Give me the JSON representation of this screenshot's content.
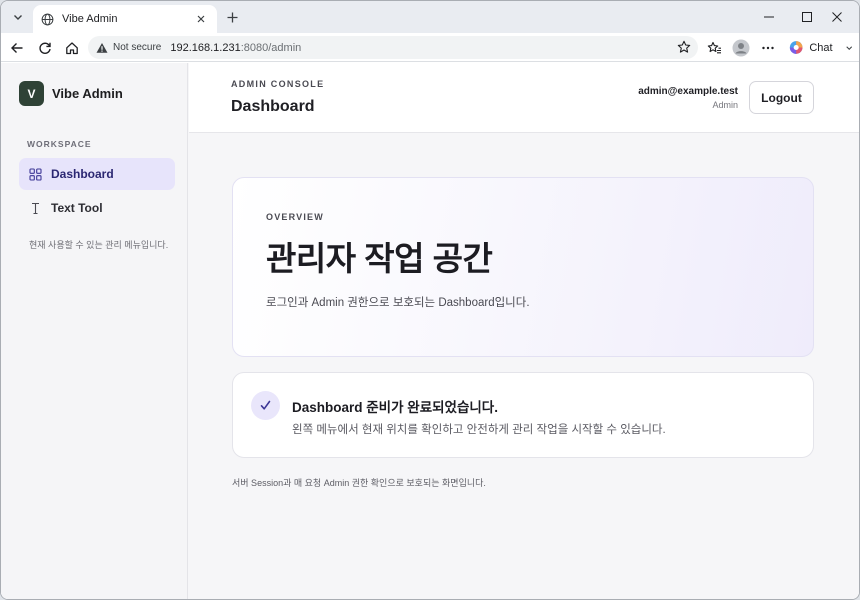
{
  "browser": {
    "tab_title": "Vibe Admin",
    "not_secure_label": "Not secure",
    "url_host": "192.168.1.231",
    "url_rest": ":8080/admin",
    "chat_label": "Chat"
  },
  "sidebar": {
    "brand_initial": "V",
    "brand_name": "Vibe Admin",
    "section_label": "WORKSPACE",
    "items": [
      {
        "label": "Dashboard",
        "icon": "grid-icon",
        "active": true
      },
      {
        "label": "Text Tool",
        "icon": "text-cursor-icon",
        "active": false
      }
    ],
    "note": "현재 사용할 수 있는 관리 메뉴입니다."
  },
  "header": {
    "eyebrow": "ADMIN CONSOLE",
    "title": "Dashboard",
    "user_email": "admin@example.test",
    "user_role": "Admin",
    "logout_label": "Logout"
  },
  "overview": {
    "eyebrow": "OVERVIEW",
    "title": "관리자 작업 공간",
    "description": "로그인과 Admin 권한으로 보호되는 Dashboard입니다."
  },
  "status": {
    "title": "Dashboard 준비가 완료되었습니다.",
    "description": "왼쪽 메뉴에서 현재 위치를 확인하고 안전하게 관리 작업을 시작할 수 있습니다."
  },
  "footer_note": "서버 Session과 매 요청 Admin 권한 확인으로 보호되는 화면입니다.",
  "colors": {
    "accent": "#e7e4fb",
    "accent_text": "#2b2772",
    "brand_mark": "#2f4236"
  }
}
